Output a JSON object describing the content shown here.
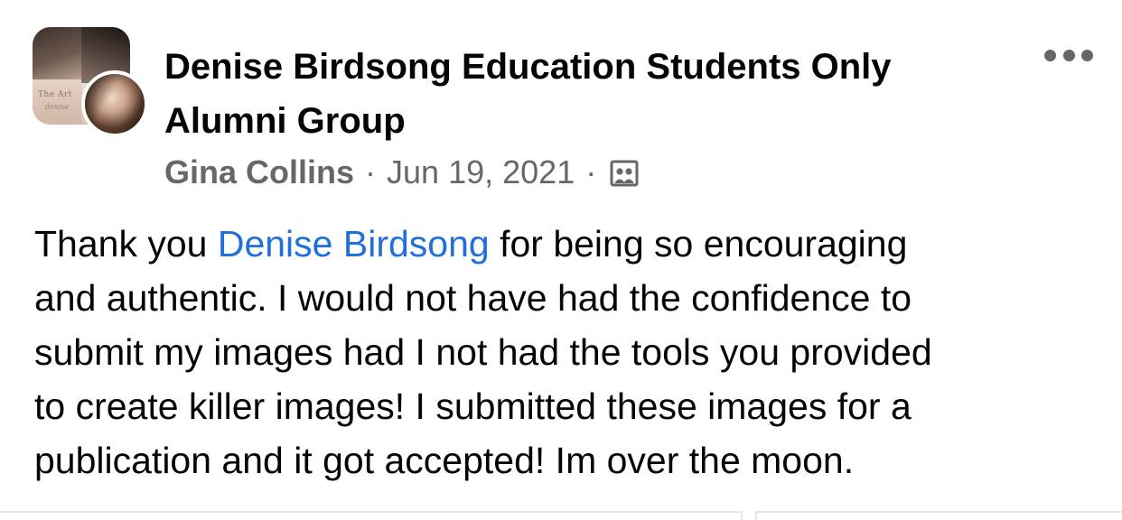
{
  "post": {
    "group_name_line1": "Denise Birdsong Education Students Only",
    "group_name_line2": "Alumni Group",
    "author": "Gina Collins",
    "separator": "·",
    "date": "Jun 19, 2021",
    "audience_icon": "members-group-icon",
    "more_icon": "more-options-icon",
    "group_logo_text": "The Art",
    "group_logo_script": "denise",
    "body": {
      "line1_before": "Thank you ",
      "mention": "Denise Birdsong",
      "line1_after": " for being so encouraging",
      "line2": "and authentic. I would not have had the confidence to",
      "line3": "submit my images had I not had the tools you provided",
      "line4": "to create killer images! I submitted these images for a",
      "line5": "publication and it got accepted! Im over the moon."
    }
  },
  "colors": {
    "primary_text": "#050505",
    "secondary_text": "#65676b",
    "link": "#216fdb",
    "divider": "#e4e6eb"
  }
}
